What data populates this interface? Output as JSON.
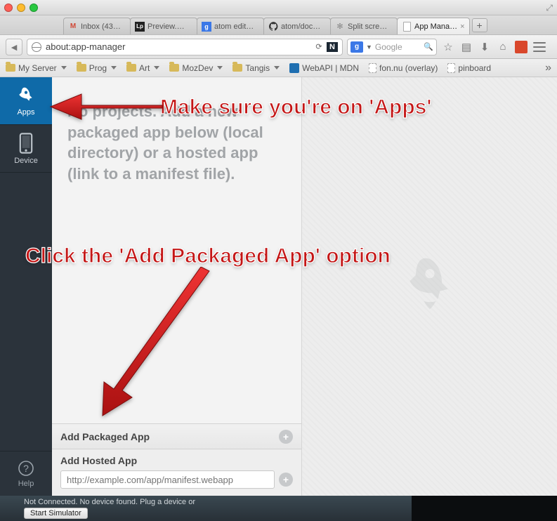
{
  "window": {
    "tabs": [
      {
        "label": "Inbox (43…",
        "icon": "gmail"
      },
      {
        "label": "Preview.…",
        "icon": "lp"
      },
      {
        "label": "atom edit…",
        "icon": "google"
      },
      {
        "label": "atom/doc…",
        "icon": "github"
      },
      {
        "label": "Split scre…",
        "icon": "gear"
      },
      {
        "label": "App Mana…",
        "icon": "generic",
        "active": true
      }
    ]
  },
  "toolbar": {
    "url": "about:app-manager",
    "search_engine_label": "g",
    "search_placeholder": "Google"
  },
  "bookmarks": {
    "items": [
      {
        "label": "My Server",
        "type": "folder"
      },
      {
        "label": "Prog",
        "type": "folder"
      },
      {
        "label": "Art",
        "type": "folder"
      },
      {
        "label": "MozDev",
        "type": "folder"
      },
      {
        "label": "Tangis",
        "type": "folder"
      },
      {
        "label": "WebAPI | MDN",
        "type": "page-blue"
      },
      {
        "label": "fon.nu (overlay)",
        "type": "page"
      },
      {
        "label": "pinboard",
        "type": "page"
      }
    ]
  },
  "sidebar": {
    "apps_label": "Apps",
    "device_label": "Device",
    "help_label": "Help"
  },
  "panel": {
    "empty_message": "No projects. Add a new packaged app below (local directory) or a hosted app (link to a manifest file).",
    "add_packaged_label": "Add Packaged App",
    "add_hosted_label": "Add Hosted App",
    "hosted_placeholder": "http://example.com/app/manifest.webapp"
  },
  "footer": {
    "status_text": "Not Connected. No device found. Plug a device or",
    "start_simulator_label": "Start Simulator"
  },
  "annotations": {
    "line1": "Make sure you're on 'Apps'",
    "line2": "Click the 'Add Packaged App' option"
  }
}
